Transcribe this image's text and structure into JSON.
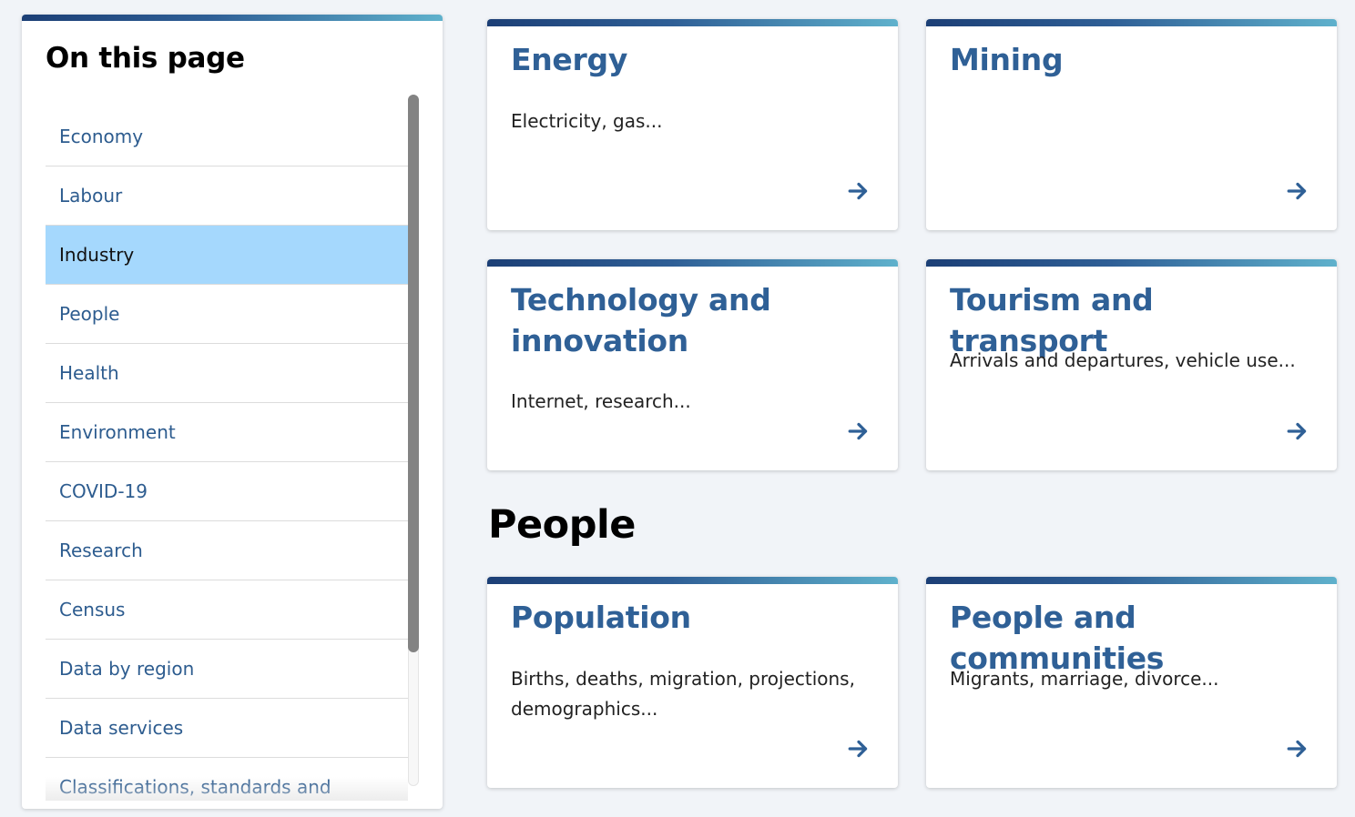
{
  "toc": {
    "title": "On this page",
    "items": [
      {
        "label": "Economy",
        "active": false
      },
      {
        "label": "Labour",
        "active": false
      },
      {
        "label": "Industry",
        "active": true
      },
      {
        "label": "People",
        "active": false
      },
      {
        "label": "Health",
        "active": false
      },
      {
        "label": "Environment",
        "active": false
      },
      {
        "label": "COVID-19",
        "active": false
      },
      {
        "label": "Research",
        "active": false
      },
      {
        "label": "Census",
        "active": false
      },
      {
        "label": "Data by region",
        "active": false
      },
      {
        "label": "Data services",
        "active": false
      },
      {
        "label": "Classifications, standards and",
        "active": false
      }
    ]
  },
  "industry_cards": [
    {
      "title": "Energy",
      "description": "Electricity, gas...",
      "icon": "arrow-right-icon"
    },
    {
      "title": "Mining",
      "description": "",
      "icon": "arrow-right-icon"
    },
    {
      "title": "Technology and innovation",
      "description": "Internet, research...",
      "icon": "arrow-right-icon"
    },
    {
      "title": "Tourism and transport",
      "description": "Arrivals and departures, vehicle use...",
      "icon": "arrow-right-icon"
    }
  ],
  "people_section": {
    "heading": "People",
    "cards": [
      {
        "title": "Population",
        "description": "Births, deaths, migration, projections, demographics...",
        "icon": "arrow-right-icon"
      },
      {
        "title": "People and communities",
        "description": "Migrants, marriage, divorce...",
        "icon": "arrow-right-icon"
      }
    ]
  },
  "colors": {
    "accent_blue": "#2f6096",
    "link_blue": "#2d5c8f",
    "active_item_bg": "#a5d8fd",
    "gradient_start": "#1c3f76",
    "gradient_end": "#5fb1cc",
    "page_bg": "#f1f4f8"
  }
}
